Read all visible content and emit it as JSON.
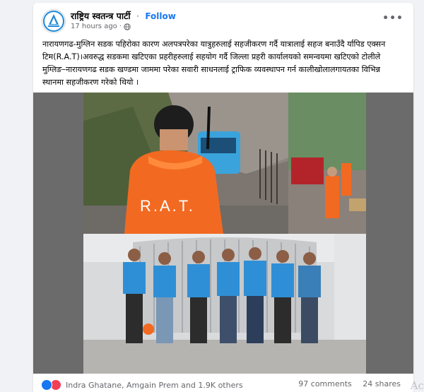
{
  "post": {
    "page_name": "राष्ट्रिय स्वतन्त्र पार्टी",
    "separator": "·",
    "follow_label": "Follow",
    "time": "17 hours ago",
    "time_sep": "·",
    "text": "नारायणगढ-मुग्लिन सडक पहिरोका कारण अलपत्रपरेका यात्रुहरुलाई सहजीकरण गर्दै यात्रालाई सहज बनाउँदै र्यापिड एक्सन टिम(R.A.T)।अवरुद्ध सडकमा खटिएका प्रहरीहरुलाई सहयोग गर्दै जिल्ला प्रहरी कार्यालयको समन्वयमा खटिएको टोलीले मुग्लिङ–नारायणगढ सडक खण्डमा जाममा परेका सवारी साधनलाई ट्राफिक व्यवस्थापन गर्न कालीखोलालगायतका विभिन्न स्थानमा सहजीकरण गरेको थियो ।"
  },
  "photo1": {
    "vest_text": "R.A.T."
  },
  "footer": {
    "reaction_names": "Indra Ghatane, Amgain Prem and 1.9K others",
    "comments": "97 comments",
    "shares": "24 shares"
  },
  "watermark": "Act",
  "colors": {
    "link": "#1877f2",
    "like": "#1877f2",
    "love": "#f33e58",
    "vest_orange": "#f26a21",
    "rat_blue": "#2f8fd6"
  },
  "icons": [
    "party-logo-icon",
    "globe-icon",
    "more-icon",
    "like-reaction-icon",
    "love-reaction-icon"
  ]
}
